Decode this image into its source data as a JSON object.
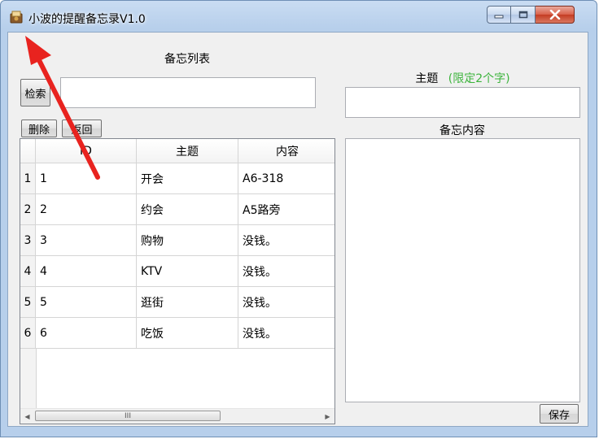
{
  "window": {
    "title": "小波的提醒备忘录V1.0",
    "icon": "notebook-app-icon"
  },
  "titlebar_buttons": {
    "minimize_icon": "minimize-icon",
    "maximize_icon": "maximize-icon",
    "close_icon": "close-icon"
  },
  "left_panel": {
    "list_title": "备忘列表",
    "search_button": "检索",
    "search_value": "",
    "delete_button": "删除",
    "back_button": "返回"
  },
  "grid": {
    "columns": [
      "ID",
      "主题",
      "内容"
    ],
    "rows": [
      {
        "row_header": "1",
        "id": "1",
        "subject": "开会",
        "content": "A6-318"
      },
      {
        "row_header": "2",
        "id": "2",
        "subject": "约会",
        "content": "A5路旁"
      },
      {
        "row_header": "3",
        "id": "3",
        "subject": "购物",
        "content": "没钱。"
      },
      {
        "row_header": "4",
        "id": "4",
        "subject": "KTV",
        "content": "没钱。"
      },
      {
        "row_header": "5",
        "id": "5",
        "subject": "逛街",
        "content": "没钱。"
      },
      {
        "row_header": "6",
        "id": "6",
        "subject": "吃饭",
        "content": "没钱。"
      }
    ],
    "scroll_thumb_grip": "III"
  },
  "right_panel": {
    "subject_label": "主题",
    "subject_hint": "(限定2个字)",
    "subject_value": "",
    "content_label": "备忘内容",
    "content_value": "",
    "save_button": "保存"
  },
  "colors": {
    "hint_green": "#3cb43c",
    "annotation_arrow": "#e8231f"
  }
}
